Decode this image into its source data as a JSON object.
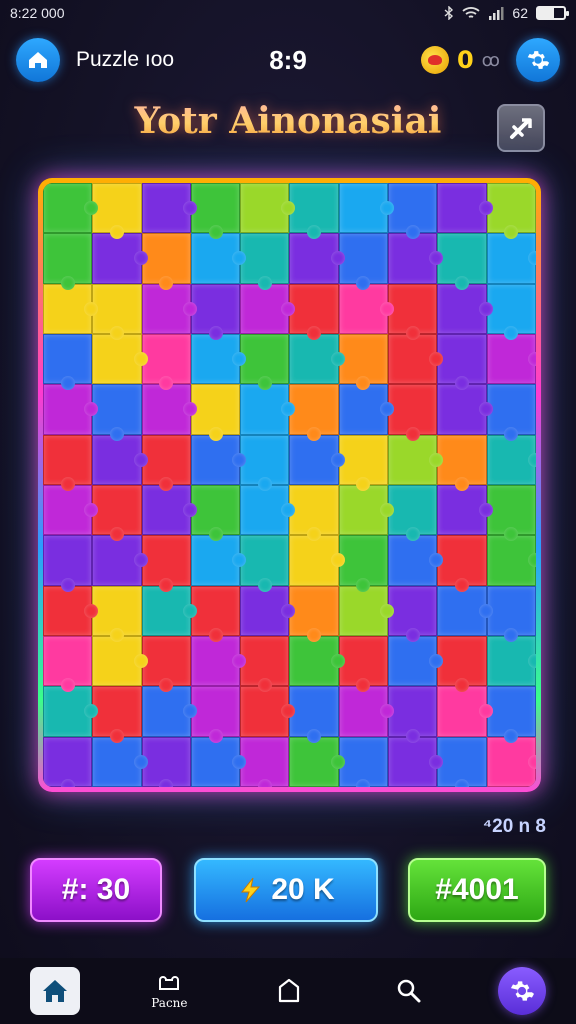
{
  "status_bar": {
    "time": "8:22 000",
    "battery": "62",
    "battery_level": 0.62
  },
  "header": {
    "back_icon": "home-arrow-icon",
    "title": "Puzzle ıoo",
    "time": "8:9",
    "coins": "0",
    "coins_extra": "ꝏ",
    "settings_icon": "gear-icon"
  },
  "title": "Yotr Ainonasiai",
  "shuffle_icon": "shuffle-icon",
  "move_hint": "⁴20 n 8",
  "buttons": {
    "left": "#: 30",
    "middle": "20 K",
    "right": "#4001"
  },
  "nav": {
    "home_icon": "home-icon",
    "puzzle_icon": "puzzle-icon",
    "puzzle_label": "Pacne",
    "box_icon": "box-icon",
    "search_icon": "search-icon",
    "settings_icon": "gear-icon"
  },
  "colors": {
    "green": "#3ec43a",
    "lime": "#9ad82a",
    "yellow": "#f5d21a",
    "orange": "#ff8a1a",
    "red": "#f0303a",
    "pink": "#ff3aa0",
    "magenta": "#c028d8",
    "purple": "#7a2ee0",
    "blue": "#2f6ff0",
    "sky": "#1aa8f0",
    "teal": "#18b8b0"
  },
  "board_grid": [
    [
      "green",
      "yellow",
      "purple",
      "green",
      "lime",
      "teal",
      "sky",
      "blue",
      "purple",
      "lime"
    ],
    [
      "green",
      "purple",
      "orange",
      "sky",
      "teal",
      "purple",
      "blue",
      "purple",
      "teal",
      "sky"
    ],
    [
      "yellow",
      "yellow",
      "magenta",
      "purple",
      "magenta",
      "red",
      "pink",
      "red",
      "purple",
      "sky"
    ],
    [
      "blue",
      "yellow",
      "pink",
      "sky",
      "green",
      "teal",
      "orange",
      "red",
      "purple",
      "magenta"
    ],
    [
      "magenta",
      "blue",
      "magenta",
      "yellow",
      "sky",
      "orange",
      "blue",
      "red",
      "purple",
      "blue"
    ],
    [
      "red",
      "purple",
      "red",
      "blue",
      "sky",
      "blue",
      "yellow",
      "lime",
      "orange",
      "teal"
    ],
    [
      "magenta",
      "red",
      "purple",
      "green",
      "sky",
      "yellow",
      "lime",
      "teal",
      "purple",
      "green"
    ],
    [
      "purple",
      "purple",
      "red",
      "sky",
      "teal",
      "yellow",
      "green",
      "blue",
      "red",
      "green"
    ],
    [
      "red",
      "yellow",
      "teal",
      "red",
      "purple",
      "orange",
      "lime",
      "purple",
      "blue",
      "blue"
    ],
    [
      "pink",
      "yellow",
      "red",
      "magenta",
      "red",
      "green",
      "red",
      "blue",
      "red",
      "teal"
    ],
    [
      "teal",
      "red",
      "blue",
      "magenta",
      "red",
      "blue",
      "magenta",
      "purple",
      "pink",
      "blue"
    ],
    [
      "purple",
      "blue",
      "purple",
      "blue",
      "magenta",
      "green",
      "blue",
      "purple",
      "blue",
      "pink"
    ]
  ]
}
